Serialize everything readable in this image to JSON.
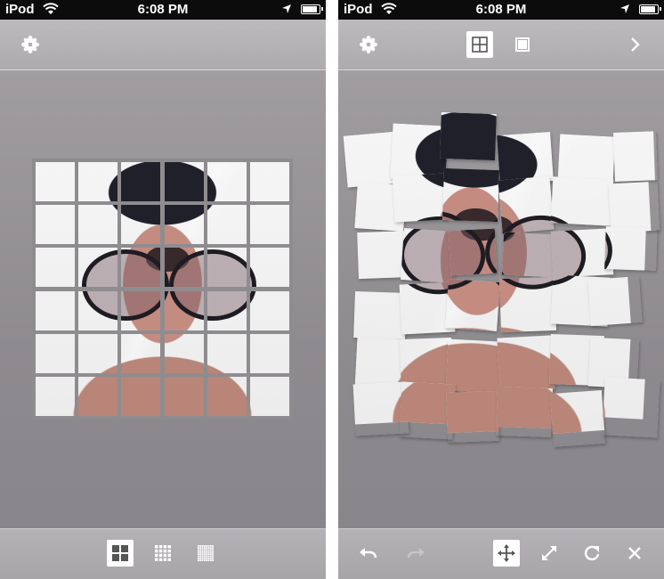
{
  "left_screen": {
    "status": {
      "carrier": "iPod",
      "time": "6:08 PM"
    },
    "toolbar": {
      "settings_icon": "flower-icon"
    },
    "bottom": {
      "buttons": [
        {
          "icon": "grid-2x2-icon",
          "selected": true
        },
        {
          "icon": "grid-4x4-icon",
          "selected": false
        },
        {
          "icon": "grid-8x8-icon",
          "selected": false
        }
      ]
    },
    "photo": {
      "rows": 6,
      "cols": 6,
      "description": "selfie photo split into grid"
    }
  },
  "right_screen": {
    "status": {
      "carrier": "iPod",
      "time": "6:08 PM"
    },
    "toolbar": {
      "settings_icon": "flower-icon",
      "modes": [
        {
          "icon": "grid-mode-icon",
          "selected": true
        },
        {
          "icon": "single-mode-icon",
          "selected": false
        }
      ],
      "next_icon": "chevron-right-icon"
    },
    "bottom": {
      "buttons": [
        {
          "icon": "undo-icon",
          "enabled": true
        },
        {
          "icon": "redo-icon",
          "enabled": false
        },
        {
          "icon": "move-icon",
          "selected": true
        },
        {
          "icon": "resize-icon",
          "selected": false
        },
        {
          "icon": "rotate-icon",
          "selected": false
        },
        {
          "icon": "close-icon",
          "selected": false
        }
      ]
    }
  },
  "colors": {
    "toolbar": "#b3b1b4",
    "accent_white": "#ffffff",
    "statusbar": "#0c0c0c"
  }
}
